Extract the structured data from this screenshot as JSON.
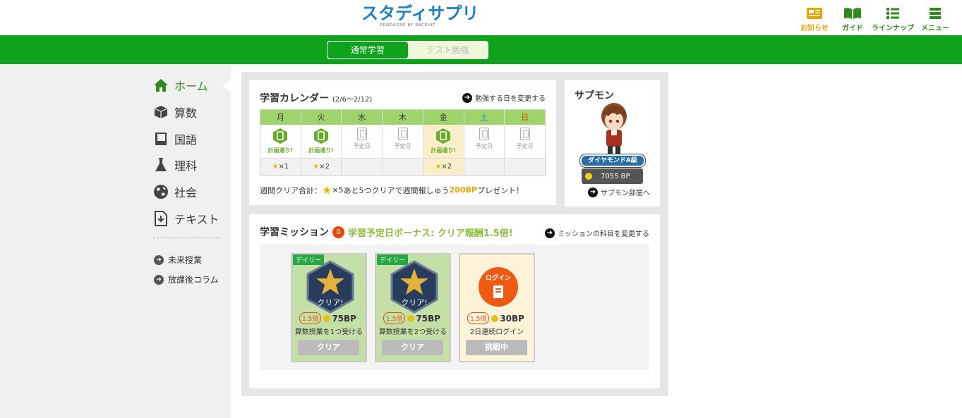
{
  "header": {
    "logo_text": "スタディサプリ",
    "logo_sub": "PRODUCED BY RECRUIT",
    "nav": [
      {
        "label": "お知らせ",
        "icon": "news-icon",
        "color": "#e6a400"
      },
      {
        "label": "ガイド",
        "icon": "book-icon",
        "color": "#2e8b1a"
      },
      {
        "label": "ラインナップ",
        "icon": "list-icon",
        "color": "#2e8b1a"
      },
      {
        "label": "メニュー",
        "icon": "menu-icon",
        "color": "#2e8b1a"
      }
    ]
  },
  "tabs": {
    "active": "通常学習",
    "inactive": "テスト勉強"
  },
  "sidebar": {
    "items": [
      {
        "label": "ホーム",
        "icon": "home-icon"
      },
      {
        "label": "算数",
        "icon": "cube-icon"
      },
      {
        "label": "国語",
        "icon": "notebook-icon"
      },
      {
        "label": "理科",
        "icon": "flask-icon"
      },
      {
        "label": "社会",
        "icon": "globe-icon"
      },
      {
        "label": "テキスト",
        "icon": "download-doc-icon"
      }
    ],
    "links": [
      {
        "label": "未来授業"
      },
      {
        "label": "放課後コラム"
      }
    ]
  },
  "calendar": {
    "title": "学習カレンダー",
    "range": "(2/6〜2/12)",
    "change_link": "勉強する日を変更する",
    "days": [
      {
        "day": "月",
        "status": "計画通り!",
        "type": "ok",
        "stars": "×1",
        "day_color": "#333"
      },
      {
        "day": "火",
        "status": "計画通り!",
        "type": "ok",
        "stars": "×2",
        "day_color": "#333"
      },
      {
        "day": "水",
        "status": "予定日",
        "type": "plan",
        "stars": "",
        "day_color": "#333"
      },
      {
        "day": "木",
        "status": "予定日",
        "type": "plan",
        "stars": "",
        "day_color": "#333"
      },
      {
        "day": "金",
        "status": "計画通り!",
        "type": "ok",
        "stars": "×2",
        "day_color": "#333"
      },
      {
        "day": "土",
        "status": "予定日",
        "type": "plan",
        "stars": "",
        "day_color": "#2a7cd0"
      },
      {
        "day": "日",
        "status": "予定日",
        "type": "plan",
        "stars": "",
        "day_color": "#e64a0c"
      }
    ],
    "weekly_prefix": "週間クリア合計：",
    "weekly_count": "×5",
    "weekly_mid": " あと5つクリアで週間報しゅう",
    "weekly_bp": "200BP",
    "weekly_suffix": "プレゼント！"
  },
  "sapmon": {
    "name": "サプモン",
    "rank": "ダイヤモンドA級",
    "bp": "7055 BP",
    "room_link": "サプモン部屋へ"
  },
  "missions": {
    "title": "学習ミッション",
    "count": "0",
    "bonus": "学習予定日ボーナス: クリア報酬1.5倍!",
    "change_link": "ミッションの科目を変更する",
    "cards": [
      {
        "tag": "デイリー",
        "medal_text": "クリア!",
        "mult": "1.5倍",
        "bp": "75BP",
        "desc": "算数授業を1つ受ける",
        "button": "クリア",
        "state": "done"
      },
      {
        "tag": "デイリー",
        "medal_text": "クリア!",
        "mult": "1.5倍",
        "bp": "75BP",
        "desc": "算数授業を2つ受ける",
        "button": "クリア",
        "state": "done"
      },
      {
        "tag": "",
        "medal_text": "ログイン",
        "mult": "1.5倍",
        "bp": "30BP",
        "desc": "2日連続ログイン",
        "button": "挑戦中",
        "state": "open"
      }
    ]
  }
}
